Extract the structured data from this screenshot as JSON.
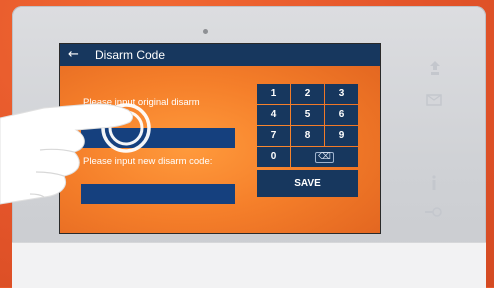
{
  "screen": {
    "title": "Disarm Code",
    "back_icon": "←",
    "original_label": "Please input original disarm code:",
    "new_label": "Please input new disarm code:",
    "original_value": "",
    "new_value": ""
  },
  "keypad": {
    "keys": [
      "1",
      "2",
      "3",
      "4",
      "5",
      "6",
      "7",
      "8",
      "9",
      "0"
    ],
    "delete_icon": "⌫",
    "save_label": "SAVE"
  },
  "side_icons": {
    "top": "monitor-icon",
    "second": "message-icon",
    "third": "info-icon",
    "bottom": "unlock-icon"
  },
  "colors": {
    "screen_orange": "#f57f2a",
    "bar_blue": "#17375e",
    "field_blue": "#15407e",
    "device_gray": "#d6d7da"
  }
}
